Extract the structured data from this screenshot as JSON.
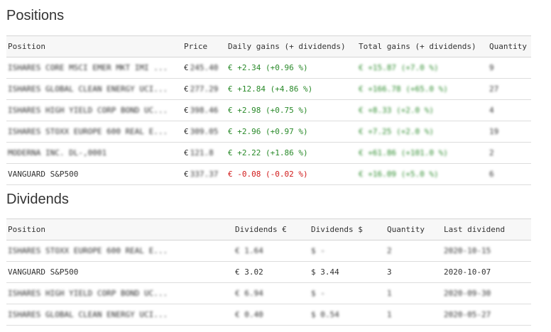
{
  "positions": {
    "title": "Positions",
    "columns": [
      "Position",
      "Price",
      "Daily gains (+ dividends)",
      "Total gains (+ dividends)",
      "Quantity"
    ],
    "rows": [
      {
        "name": "ISHARES CORE MSCI EMER MKT IMI ...",
        "currency": "€",
        "price": "245.40",
        "daily": "€ +2.34 (+0.96 %)",
        "total": "€ +15.87 (+7.0 %)",
        "quantity": "9",
        "blur_name": true,
        "blur_price": true,
        "blur_total": true,
        "blur_qty": true,
        "daily_sign": "pos"
      },
      {
        "name": "ISHARES GLOBAL CLEAN ENERGY UCI...",
        "currency": "€",
        "price": "277.29",
        "daily": "€ +12.84 (+4.86 %)",
        "total": "€ +166.78 (+65.0 %)",
        "quantity": "27",
        "blur_name": true,
        "blur_price": true,
        "blur_total": true,
        "blur_qty": true,
        "daily_sign": "pos"
      },
      {
        "name": "ISHARES HIGH YIELD CORP BOND UC...",
        "currency": "€",
        "price": "398.46",
        "daily": "€ +2.98 (+0.75 %)",
        "total": "€ +8.33 (+2.0 %)",
        "quantity": "4",
        "blur_name": true,
        "blur_price": true,
        "blur_total": true,
        "blur_qty": true,
        "daily_sign": "pos"
      },
      {
        "name": "ISHARES STOXX EUROPE 600 REAL E...",
        "currency": "€",
        "price": "309.05",
        "daily": "€ +2.96 (+0.97 %)",
        "total": "€ +7.25 (+2.0 %)",
        "quantity": "19",
        "blur_name": true,
        "blur_price": true,
        "blur_total": true,
        "blur_qty": true,
        "daily_sign": "pos"
      },
      {
        "name": "MODERNA INC. DL-,0001",
        "currency": "€",
        "price": "121.8",
        "daily": "€ +2.22 (+1.86 %)",
        "total": "€ +61.86 (+101.0 %)",
        "quantity": "2",
        "blur_name": true,
        "blur_price": true,
        "blur_total": true,
        "blur_qty": true,
        "daily_sign": "pos"
      },
      {
        "name": "VANGUARD S&P500",
        "currency": "€",
        "price": "337.37",
        "daily": "€ -0.08 (-0.02 %)",
        "total": "€ +16.09 (+5.0 %)",
        "quantity": "6",
        "blur_name": false,
        "blur_price": true,
        "blur_total": true,
        "blur_qty": true,
        "daily_sign": "neg"
      }
    ]
  },
  "dividends": {
    "title": "Dividends",
    "columns": [
      "Position",
      "Dividends €",
      "Dividends $",
      "Quantity",
      "Last dividend"
    ],
    "rows": [
      {
        "name": "ISHARES STOXX EUROPE 600 REAL E...",
        "eur": "€ 1.64",
        "usd": "$ -",
        "quantity": "2",
        "date": "2020-10-15",
        "blur": true
      },
      {
        "name": "VANGUARD S&P500",
        "eur": "€ 3.02",
        "usd": "$ 3.44",
        "quantity": "3",
        "date": "2020-10-07",
        "blur": false
      },
      {
        "name": "ISHARES HIGH YIELD CORP BOND UC...",
        "eur": "€ 6.94",
        "usd": "$ -",
        "quantity": "1",
        "date": "2020-09-30",
        "blur": true
      },
      {
        "name": "ISHARES GLOBAL CLEAN ENERGY UCI...",
        "eur": "€ 0.40",
        "usd": "$ 0.54",
        "quantity": "1",
        "date": "2020-05-27",
        "blur": true
      }
    ]
  },
  "colors": {
    "positive": "#2a8a2a",
    "negative": "#d11a1a",
    "header_bg": "#f7f7f7",
    "border": "#d5d5d5"
  }
}
